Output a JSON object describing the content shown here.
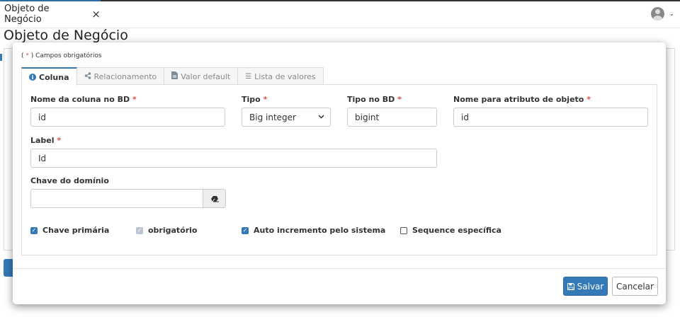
{
  "app_tab": {
    "title": "Objeto de Negócio",
    "close_icon": "×"
  },
  "user_menu": {
    "avatar_icon": "user-avatar-icon",
    "caret": "⌄"
  },
  "page_title": "Objeto de Negócio",
  "modal": {
    "required_note": {
      "open": "( ",
      "star": "*",
      "close": " ) Campos obrigatórios"
    },
    "tabs": [
      {
        "label": "Coluna",
        "icon": "info-icon",
        "glyph": "i",
        "active": true
      },
      {
        "label": "Relacionamento",
        "icon": "share-icon",
        "glyph": "⟨",
        "active": false
      },
      {
        "label": "Valor default",
        "icon": "file-icon",
        "glyph": "▤",
        "active": false
      },
      {
        "label": "Lista de valores",
        "icon": "list-icon",
        "glyph": "☰",
        "active": false
      }
    ],
    "fields": {
      "nome_coluna": {
        "label": "Nome da coluna no BD",
        "value": "id"
      },
      "tipo": {
        "label": "Tipo",
        "value": "Big integer"
      },
      "tipo_bd": {
        "label": "Tipo no BD",
        "value": "bigint"
      },
      "nome_atributo": {
        "label": "Nome para atributo de objeto",
        "value": "id"
      },
      "label": {
        "label": "Label",
        "value": "Id"
      },
      "chave_dominio": {
        "label": "Chave do domínio",
        "value": ""
      }
    },
    "required_star": "*",
    "checkboxes": [
      {
        "label": "Chave primária",
        "checked": true
      },
      {
        "label": "obrigatório",
        "checked": true,
        "disabled": true
      },
      {
        "label": "Auto incremento pelo sistema",
        "checked": true
      },
      {
        "label": "Sequence específica",
        "checked": false
      }
    ],
    "buttons": {
      "save": "Salvar",
      "cancel": "Cancelar"
    }
  },
  "colors": {
    "primary": "#337ab7",
    "required": "#d9534f"
  }
}
